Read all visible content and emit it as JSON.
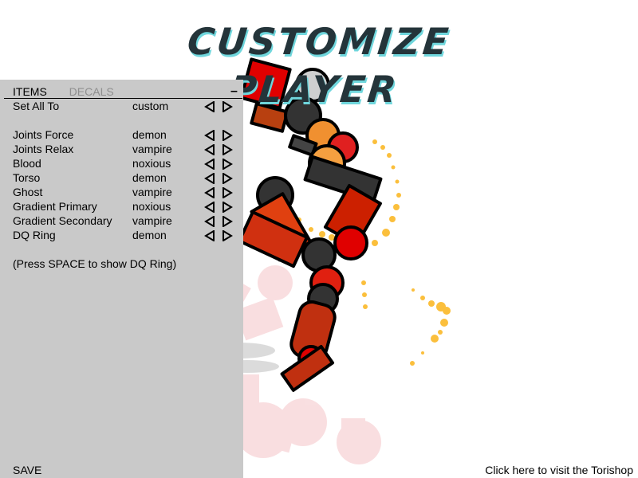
{
  "title": "CUSTOMIZE PLAYER",
  "panel": {
    "tabs": [
      {
        "label": "ITEMS",
        "active": true
      },
      {
        "label": "DECALS",
        "active": false
      }
    ],
    "minimize_label": "–",
    "set_all": {
      "label": "Set All To",
      "value": "custom"
    },
    "items": [
      {
        "label": "Joints Force",
        "value": "demon"
      },
      {
        "label": "Joints Relax",
        "value": "vampire"
      },
      {
        "label": "Blood",
        "value": "noxious"
      },
      {
        "label": "Torso",
        "value": "demon"
      },
      {
        "label": "Ghost",
        "value": "vampire"
      },
      {
        "label": "Gradient Primary",
        "value": "noxious"
      },
      {
        "label": "Gradient Secondary",
        "value": "vampire"
      },
      {
        "label": "DQ Ring",
        "value": "demon"
      }
    ],
    "hint": "(Press SPACE to show DQ Ring)",
    "save_label": "SAVE"
  },
  "footer": {
    "shop_link": "Click here to visit the Torishop"
  },
  "colors": {
    "panel_bg": "#c9c9c9",
    "title_fill": "#24343a",
    "title_shadow": "#6fd6dc",
    "inactive_tab": "#8f8f8f",
    "accent_red": "#e00000",
    "accent_orange": "#f5a030",
    "blood_yellow": "#fbbf3c"
  }
}
